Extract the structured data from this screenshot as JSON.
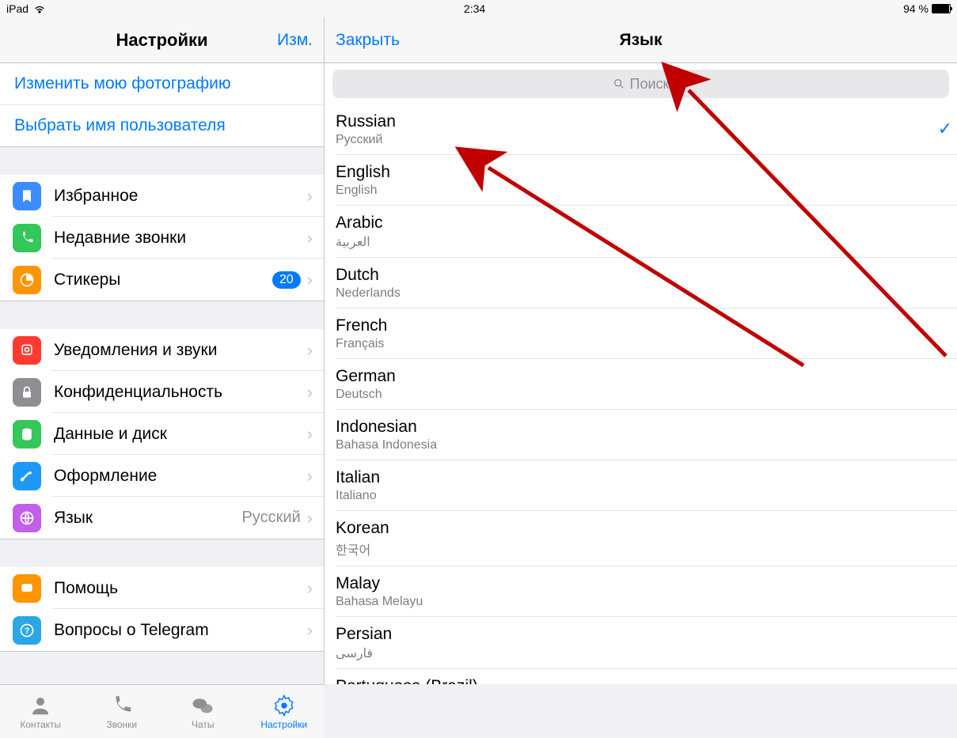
{
  "status": {
    "device": "iPad",
    "time": "2:34",
    "battery_pct": "94 %"
  },
  "left": {
    "title": "Настройки",
    "edit": "Изм.",
    "top_links": [
      "Изменить мою фотографию",
      "Выбрать имя пользователя"
    ],
    "group1": [
      {
        "icon": "bookmark",
        "color": "#3a8cff",
        "label": "Избранное"
      },
      {
        "icon": "phone",
        "color": "#34c759",
        "label": "Недавние звонки"
      },
      {
        "icon": "sticker",
        "color": "#ff9500",
        "label": "Стикеры",
        "badge": "20"
      }
    ],
    "group2": [
      {
        "icon": "bell",
        "color": "#ff3b30",
        "label": "Уведомления и звуки"
      },
      {
        "icon": "lock",
        "color": "#8e8e93",
        "label": "Конфиденциальность"
      },
      {
        "icon": "data",
        "color": "#34c759",
        "label": "Данные и диск"
      },
      {
        "icon": "brush",
        "color": "#1e98f7",
        "label": "Оформление"
      },
      {
        "icon": "globe",
        "color": "#c060e8",
        "label": "Язык",
        "value": "Русский"
      }
    ],
    "group3": [
      {
        "icon": "chat",
        "color": "#ff9500",
        "label": "Помощь"
      },
      {
        "icon": "question",
        "color": "#2aa7e6",
        "label": "Вопросы о Telegram"
      }
    ]
  },
  "right": {
    "close": "Закрыть",
    "title": "Язык",
    "search_placeholder": "Поиск",
    "languages": [
      {
        "name": "Russian",
        "native": "Русский",
        "selected": true
      },
      {
        "name": "English",
        "native": "English"
      },
      {
        "name": "Arabic",
        "native": "العربية"
      },
      {
        "name": "Dutch",
        "native": "Nederlands"
      },
      {
        "name": "French",
        "native": "Français"
      },
      {
        "name": "German",
        "native": "Deutsch"
      },
      {
        "name": "Indonesian",
        "native": "Bahasa Indonesia"
      },
      {
        "name": "Italian",
        "native": "Italiano"
      },
      {
        "name": "Korean",
        "native": "한국어"
      },
      {
        "name": "Malay",
        "native": "Bahasa Melayu"
      },
      {
        "name": "Persian",
        "native": "فارسی"
      },
      {
        "name": "Portuguese (Brazil)",
        "native": ""
      }
    ]
  },
  "tabs": [
    {
      "id": "contacts",
      "label": "Контакты"
    },
    {
      "id": "calls",
      "label": "Звонки"
    },
    {
      "id": "chats",
      "label": "Чаты"
    },
    {
      "id": "settings",
      "label": "Настройки",
      "active": true
    }
  ]
}
